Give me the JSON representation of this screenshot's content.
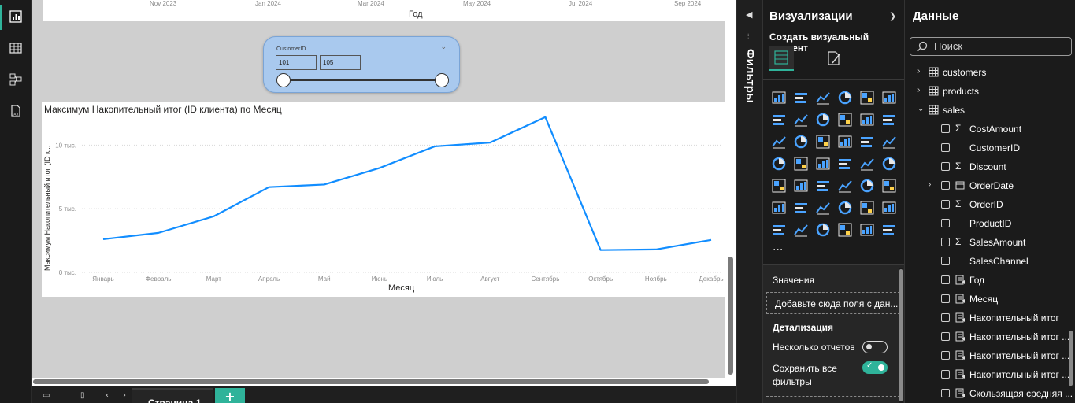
{
  "top_visual": {
    "x_ticks": [
      "Nov 2023",
      "Jan 2024",
      "Mar 2024",
      "May 2024",
      "Jul 2024",
      "Sep 2024"
    ],
    "x_title": "Год"
  },
  "slicer": {
    "title": "CustomerID",
    "min_value": "101",
    "max_value": "105"
  },
  "chart": {
    "title": "Максимум Накопительный итог (ID клиента) по Месяц",
    "y_title": "Максимум Накопительный итог (ID к...",
    "x_title": "Месяц",
    "y_ticks": [
      "0 тыс.",
      "5 тыс.",
      "10 тыс."
    ]
  },
  "chart_data": {
    "type": "line",
    "title": "Максимум Накопительный итог (ID клиента) по Месяц",
    "xlabel": "Месяц",
    "ylabel": "Максимум Накопительный итог (ID к...",
    "categories": [
      "Январь",
      "Февраль",
      "Март",
      "Апрель",
      "Май",
      "Июнь",
      "Июль",
      "Август",
      "Сентябрь",
      "Октябрь",
      "Ноябрь",
      "Декабрь"
    ],
    "values": [
      2600,
      3100,
      4400,
      6700,
      6900,
      8200,
      9900,
      10200,
      12200,
      1750,
      1800,
      2550
    ],
    "ylim": [
      0,
      12000
    ],
    "grid": true,
    "color": "#118dff"
  },
  "pages": {
    "tab": "Страница 1",
    "add": "+"
  },
  "filters": {
    "label": "Фильтры"
  },
  "viz": {
    "title": "Визуализации",
    "subtitle": "Создать визуальный элемент",
    "more": "...",
    "values_header": "Значения",
    "values_placeholder": "Добавьте сюда поля с дан...",
    "drill_header": "Детализация",
    "cross_report_label": "Несколько отчетов",
    "keep_filters_label_1": "Сохранить все",
    "keep_filters_label_2": "фильтры"
  },
  "data_pane": {
    "title": "Данные",
    "search_placeholder": "Поиск",
    "tables": [
      "customers",
      "products",
      "sales"
    ],
    "fields": [
      {
        "name": "CostAmount",
        "kind": "sum"
      },
      {
        "name": "CustomerID",
        "kind": "plain"
      },
      {
        "name": "Discount",
        "kind": "sum"
      },
      {
        "name": "OrderDate",
        "kind": "date"
      },
      {
        "name": "OrderID",
        "kind": "sum"
      },
      {
        "name": "ProductID",
        "kind": "plain"
      },
      {
        "name": "SalesAmount",
        "kind": "sum"
      },
      {
        "name": "SalesChannel",
        "kind": "plain"
      },
      {
        "name": "Год",
        "kind": "calc"
      },
      {
        "name": "Месяц",
        "kind": "calc"
      },
      {
        "name": "Накопительный итог",
        "kind": "calc"
      },
      {
        "name": "Накопительный итог ...",
        "kind": "calc"
      },
      {
        "name": "Накопительный итог ...",
        "kind": "calc"
      },
      {
        "name": "Накопительный итог ...",
        "kind": "calc"
      },
      {
        "name": "Скользящая средняя ...",
        "kind": "calc"
      }
    ]
  },
  "colors": {
    "accent": "#2fb39a",
    "line": "#118dff",
    "slicer_bg": "#a9c9ee"
  }
}
